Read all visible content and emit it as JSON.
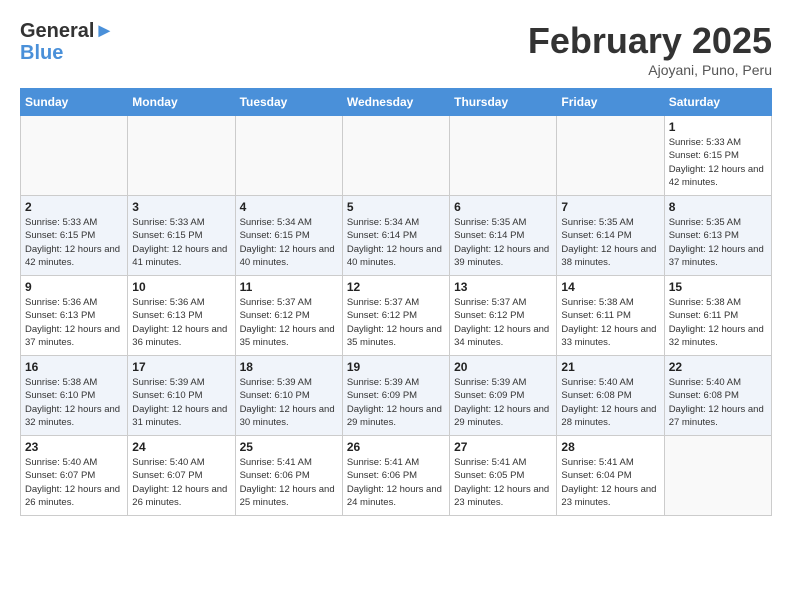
{
  "logo": {
    "line1": "General",
    "line2": "Blue"
  },
  "title": "February 2025",
  "location": "Ajoyani, Puno, Peru",
  "days_of_week": [
    "Sunday",
    "Monday",
    "Tuesday",
    "Wednesday",
    "Thursday",
    "Friday",
    "Saturday"
  ],
  "weeks": [
    [
      {
        "day": "",
        "info": ""
      },
      {
        "day": "",
        "info": ""
      },
      {
        "day": "",
        "info": ""
      },
      {
        "day": "",
        "info": ""
      },
      {
        "day": "",
        "info": ""
      },
      {
        "day": "",
        "info": ""
      },
      {
        "day": "1",
        "info": "Sunrise: 5:33 AM\nSunset: 6:15 PM\nDaylight: 12 hours and 42 minutes."
      }
    ],
    [
      {
        "day": "2",
        "info": "Sunrise: 5:33 AM\nSunset: 6:15 PM\nDaylight: 12 hours and 42 minutes."
      },
      {
        "day": "3",
        "info": "Sunrise: 5:33 AM\nSunset: 6:15 PM\nDaylight: 12 hours and 41 minutes."
      },
      {
        "day": "4",
        "info": "Sunrise: 5:34 AM\nSunset: 6:15 PM\nDaylight: 12 hours and 40 minutes."
      },
      {
        "day": "5",
        "info": "Sunrise: 5:34 AM\nSunset: 6:14 PM\nDaylight: 12 hours and 40 minutes."
      },
      {
        "day": "6",
        "info": "Sunrise: 5:35 AM\nSunset: 6:14 PM\nDaylight: 12 hours and 39 minutes."
      },
      {
        "day": "7",
        "info": "Sunrise: 5:35 AM\nSunset: 6:14 PM\nDaylight: 12 hours and 38 minutes."
      },
      {
        "day": "8",
        "info": "Sunrise: 5:35 AM\nSunset: 6:13 PM\nDaylight: 12 hours and 37 minutes."
      }
    ],
    [
      {
        "day": "9",
        "info": "Sunrise: 5:36 AM\nSunset: 6:13 PM\nDaylight: 12 hours and 37 minutes."
      },
      {
        "day": "10",
        "info": "Sunrise: 5:36 AM\nSunset: 6:13 PM\nDaylight: 12 hours and 36 minutes."
      },
      {
        "day": "11",
        "info": "Sunrise: 5:37 AM\nSunset: 6:12 PM\nDaylight: 12 hours and 35 minutes."
      },
      {
        "day": "12",
        "info": "Sunrise: 5:37 AM\nSunset: 6:12 PM\nDaylight: 12 hours and 35 minutes."
      },
      {
        "day": "13",
        "info": "Sunrise: 5:37 AM\nSunset: 6:12 PM\nDaylight: 12 hours and 34 minutes."
      },
      {
        "day": "14",
        "info": "Sunrise: 5:38 AM\nSunset: 6:11 PM\nDaylight: 12 hours and 33 minutes."
      },
      {
        "day": "15",
        "info": "Sunrise: 5:38 AM\nSunset: 6:11 PM\nDaylight: 12 hours and 32 minutes."
      }
    ],
    [
      {
        "day": "16",
        "info": "Sunrise: 5:38 AM\nSunset: 6:10 PM\nDaylight: 12 hours and 32 minutes."
      },
      {
        "day": "17",
        "info": "Sunrise: 5:39 AM\nSunset: 6:10 PM\nDaylight: 12 hours and 31 minutes."
      },
      {
        "day": "18",
        "info": "Sunrise: 5:39 AM\nSunset: 6:10 PM\nDaylight: 12 hours and 30 minutes."
      },
      {
        "day": "19",
        "info": "Sunrise: 5:39 AM\nSunset: 6:09 PM\nDaylight: 12 hours and 29 minutes."
      },
      {
        "day": "20",
        "info": "Sunrise: 5:39 AM\nSunset: 6:09 PM\nDaylight: 12 hours and 29 minutes."
      },
      {
        "day": "21",
        "info": "Sunrise: 5:40 AM\nSunset: 6:08 PM\nDaylight: 12 hours and 28 minutes."
      },
      {
        "day": "22",
        "info": "Sunrise: 5:40 AM\nSunset: 6:08 PM\nDaylight: 12 hours and 27 minutes."
      }
    ],
    [
      {
        "day": "23",
        "info": "Sunrise: 5:40 AM\nSunset: 6:07 PM\nDaylight: 12 hours and 26 minutes."
      },
      {
        "day": "24",
        "info": "Sunrise: 5:40 AM\nSunset: 6:07 PM\nDaylight: 12 hours and 26 minutes."
      },
      {
        "day": "25",
        "info": "Sunrise: 5:41 AM\nSunset: 6:06 PM\nDaylight: 12 hours and 25 minutes."
      },
      {
        "day": "26",
        "info": "Sunrise: 5:41 AM\nSunset: 6:06 PM\nDaylight: 12 hours and 24 minutes."
      },
      {
        "day": "27",
        "info": "Sunrise: 5:41 AM\nSunset: 6:05 PM\nDaylight: 12 hours and 23 minutes."
      },
      {
        "day": "28",
        "info": "Sunrise: 5:41 AM\nSunset: 6:04 PM\nDaylight: 12 hours and 23 minutes."
      },
      {
        "day": "",
        "info": ""
      }
    ]
  ]
}
